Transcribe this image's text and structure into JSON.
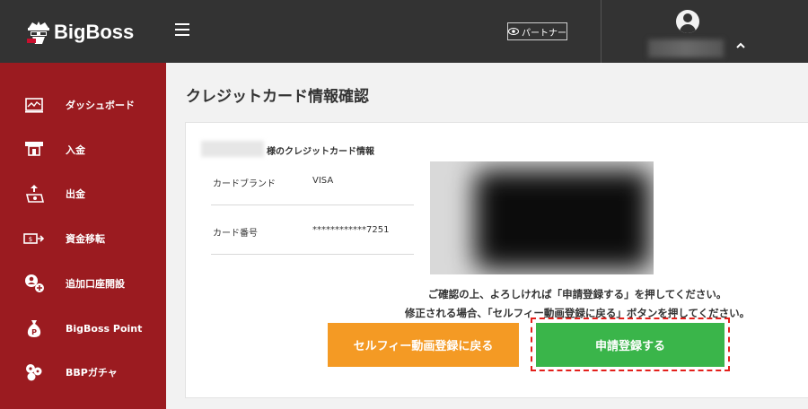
{
  "header": {
    "logo_text": "BigBoss",
    "partner_label": "パートナー"
  },
  "sidebar": {
    "items": [
      {
        "label": "ダッシュボード",
        "icon": "chart-icon"
      },
      {
        "label": "入金",
        "icon": "atm-deposit-icon"
      },
      {
        "label": "出金",
        "icon": "withdraw-icon"
      },
      {
        "label": "資金移転",
        "icon": "transfer-icon"
      },
      {
        "label": "追加口座開設",
        "icon": "add-account-icon"
      },
      {
        "label": "BigBoss Point",
        "icon": "point-bag-icon"
      },
      {
        "label": "BBPガチャ",
        "icon": "gacha-icon"
      }
    ]
  },
  "main": {
    "title": "クレジットカード情報確認",
    "holder_suffix": "様のクレジットカード情報",
    "rows": [
      {
        "label": "カードブランド",
        "value": "VISA"
      },
      {
        "label": "カード番号",
        "value": "************7251"
      }
    ],
    "notice_line1": "ご確認の上、よろしければ「申請登録する」を押してください。",
    "notice_line2": "修正される場合、「セルフィー動画登録に戻る」ボタンを押してください。",
    "back_button": "セルフィー動画登録に戻る",
    "submit_button": "申請登録する"
  },
  "colors": {
    "header_bg": "#333333",
    "sidebar_bg": "#9b1b20",
    "back_button_bg": "#f49a24",
    "submit_button_bg": "#3ab54a",
    "highlight_border": "#e3201b"
  }
}
